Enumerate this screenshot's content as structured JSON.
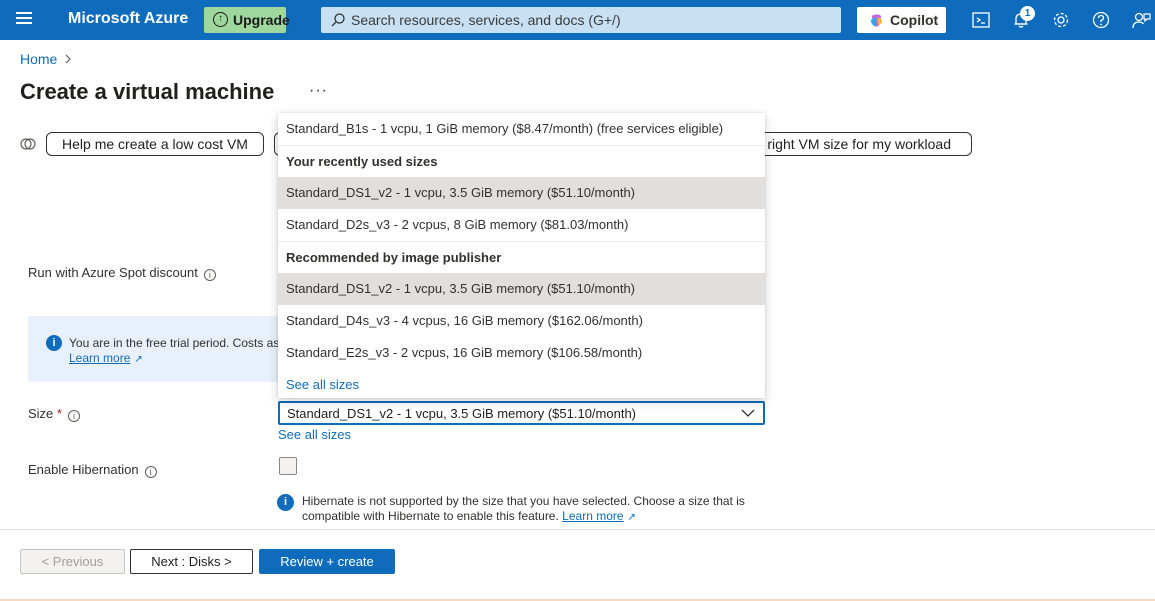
{
  "topbar": {
    "brand": "Microsoft Azure",
    "upgrade_label": "Upgrade",
    "search_placeholder": "Search resources, services, and docs (G+/)",
    "copilot_label": "Copilot",
    "notification_count": "1",
    "icons": [
      "menu-icon",
      "cloud-shell-icon",
      "notifications-icon",
      "settings-icon",
      "help-icon",
      "feedback-icon"
    ],
    "bar_color": "#0f6cbd"
  },
  "breadcrumb": {
    "home": "Home"
  },
  "page": {
    "title": "Create a virtual machine",
    "more": "···"
  },
  "suggestions": {
    "items": [
      "Help me create a low cost VM",
      "e right VM size for my workload"
    ]
  },
  "form": {
    "spot_label": "Run with Azure Spot discount",
    "info_text": "You are in the free trial period. Costs as",
    "info_link": "Learn more",
    "size_label": "Size",
    "size_required": "*",
    "size_value": "Standard_DS1_v2 - 1 vcpu, 3.5 GiB memory ($51.10/month)",
    "see_all_sizes": "See all sizes",
    "hibernation_label": "Enable Hibernation",
    "hibernation_checked": false,
    "hibernate_note": "Hibernate is not supported by the size that you have selected. Choose a size that is compatible with Hibernate to enable this feature.",
    "hibernate_link": "Learn more"
  },
  "dropdown": {
    "top_option": "Standard_B1s - 1 vcpu, 1 GiB memory ($8.47/month)  (free services eligible)",
    "recent_header": "Your recently used sizes",
    "recent": [
      "Standard_DS1_v2 - 1 vcpu, 3.5 GiB memory ($51.10/month)",
      "Standard_D2s_v3 - 2 vcpus, 8 GiB memory ($81.03/month)"
    ],
    "recommended_header": "Recommended by image publisher",
    "recommended": [
      "Standard_DS1_v2 - 1 vcpu, 3.5 GiB memory ($51.10/month)",
      "Standard_D4s_v3 - 4 vcpus, 16 GiB memory ($162.06/month)",
      "Standard_E2s_v3 - 2 vcpus, 16 GiB memory ($106.58/month)"
    ],
    "see_all": "See all sizes"
  },
  "footer": {
    "previous": "< Previous",
    "next": "Next : Disks >",
    "review": "Review + create"
  }
}
